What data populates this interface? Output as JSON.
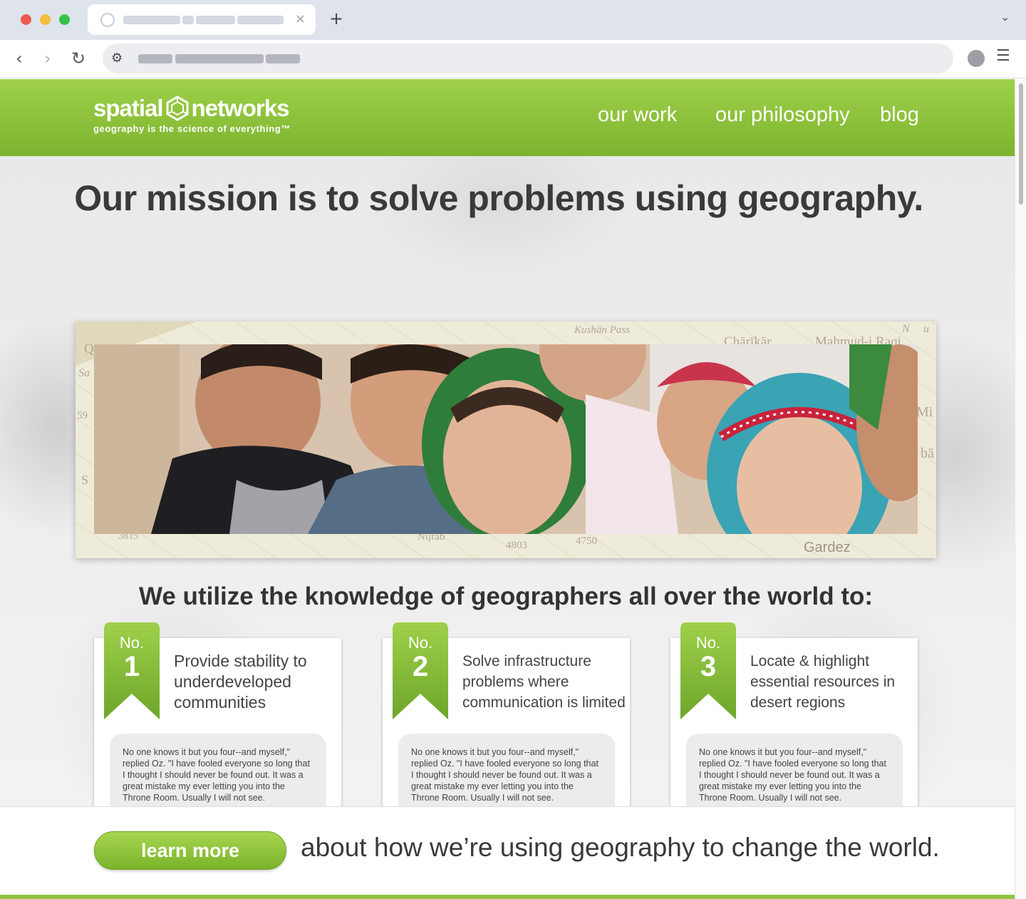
{
  "browser": {
    "tab": {
      "close_glyph": "×"
    },
    "new_tab_glyph": "+",
    "tab_menu_glyph": "⌄",
    "nav": {
      "back_glyph": "‹",
      "forward_glyph": "›",
      "reload_glyph": "↻",
      "site_info_glyph": "⚙",
      "menu_glyph": "☰"
    }
  },
  "header": {
    "logo": {
      "word1": "spatial",
      "word2": "networks",
      "tagline": "geography is the science of everything™"
    },
    "nav": [
      {
        "label": "our work"
      },
      {
        "label": "our philosophy"
      },
      {
        "label": "blog"
      }
    ],
    "colors": {
      "green_top": "#9fd14a",
      "green_bottom": "#7cb32e"
    }
  },
  "hero": {
    "mission": "Our mission is to solve problems using geography.",
    "map_labels": [
      "Kushān Pass",
      "Chārīkār",
      "Mahmud-i Raqi",
      "Gardez",
      "4803",
      "4750",
      "3815",
      "Nijrāb",
      "Sa",
      "Q",
      "59",
      "S",
      "Mi",
      "bā",
      "N",
      "u"
    ],
    "utilize": "We utilize the knowledge of geographers all over the world to:"
  },
  "cards": [
    {
      "no": "No.",
      "num": "1",
      "title": "Provide stability to underdeveloped communities",
      "quote": "No one knows it but you four--and myself,\" replied Oz. \"I have fooled everyone so long that I thought I should never be found out. It was a great mistake my ever letting you into the Throne Room. Usually I will not see."
    },
    {
      "no": "No.",
      "num": "2",
      "title": "Solve infrastructure problems where communication is limited",
      "quote": "No one knows it but you four--and myself,\" replied Oz. \"I have fooled everyone so long that I thought I should never be found out. It was a great mistake my ever letting you into the Throne Room. Usually I will not see."
    },
    {
      "no": "No.",
      "num": "3",
      "title": "Locate & highlight essential resources in desert regions",
      "quote": "No one knows it but you four--and myself,\" replied Oz. \"I have fooled everyone so long that I thought I should never be found out. It was a great mistake my ever letting you into the Throne Room. Usually I will not see."
    }
  ],
  "cta": {
    "button": "learn more",
    "text": "about how we’re using geography to change the world."
  }
}
